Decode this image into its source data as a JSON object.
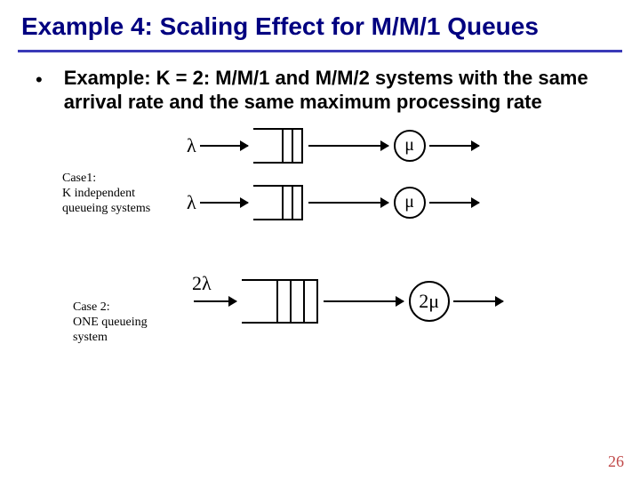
{
  "title": "Example 4: Scaling Effect for M/M/1 Queues",
  "bullet": "Example: K = 2: M/M/1 and M/M/2 systems with the same arrival rate and the same maximum processing rate",
  "case1_caption": "Case1:\nK independent\nqueueing systems",
  "case2_caption": "Case 2:\nONE queueing\nsystem",
  "symbols": {
    "lambda": "λ",
    "mu": "μ",
    "two_lambda": "2λ",
    "two_mu": "2μ"
  },
  "page_number": "26"
}
